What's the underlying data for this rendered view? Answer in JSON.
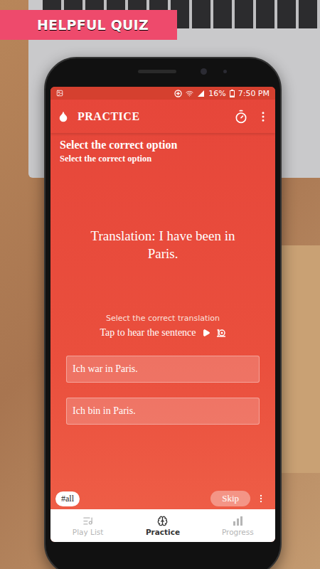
{
  "banner": "HELPFUL QUIZ",
  "status_bar": {
    "battery": "16%",
    "time": "7:50 PM"
  },
  "app_bar": {
    "title": "PRACTICE"
  },
  "prompt": {
    "title": "Select the correct option",
    "subtitle": "Select the correct option"
  },
  "question": "Translation: I have been in Paris.",
  "instruction": "Select the correct translation",
  "audio": {
    "label": "Tap to hear the sentence"
  },
  "options": [
    {
      "label": "Ich war in Paris.",
      "selected": false
    },
    {
      "label": "Ich bin in Paris.",
      "selected": false
    }
  ],
  "tag": "#all",
  "skip": "Skip",
  "nav": [
    {
      "label": "Play List",
      "selected": false
    },
    {
      "label": "Practice",
      "selected": true
    },
    {
      "label": "Progress",
      "selected": false
    }
  ]
}
